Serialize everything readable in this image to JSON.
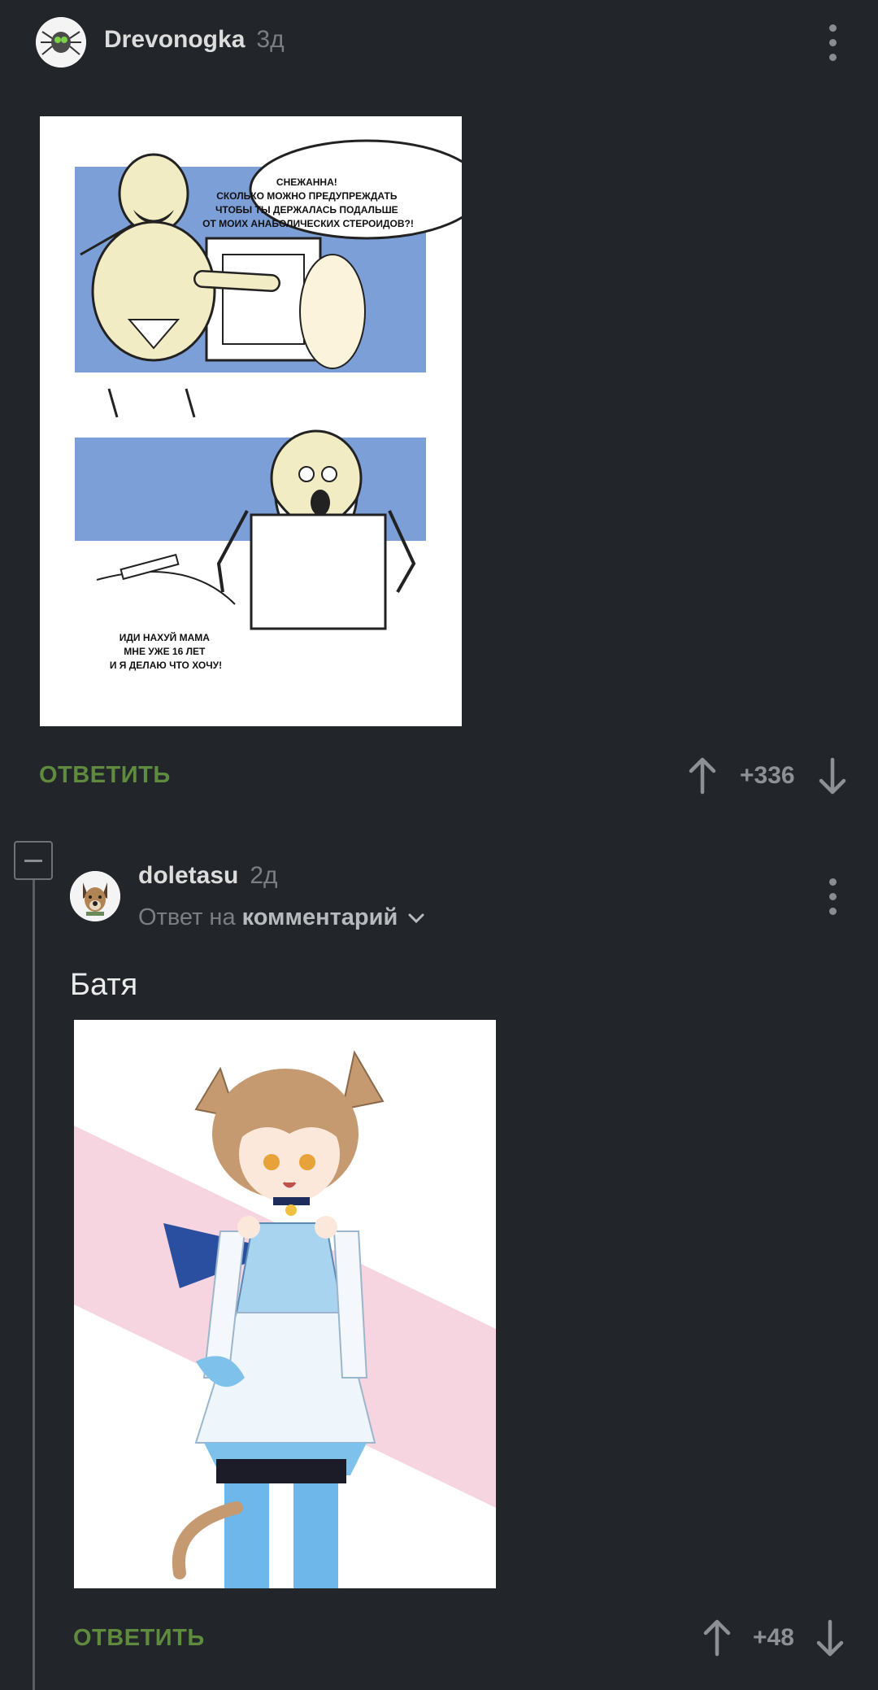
{
  "comment1": {
    "author": "Drevonogka",
    "time": "3д",
    "comic": {
      "bubble_top": "СНЕЖАННА!\nСКОЛЬКО МОЖНО ПРЕДУПРЕЖДАТЬ\nЧТОБЫ ТЫ ДЕРЖАЛАСЬ ПОДАЛЬШЕ\nОТ МОИХ АНАБОЛИЧЕСКИХ СТЕРОИДОВ?!",
      "bubble_bottom": "ИДИ НАХУЙ МАМА\nМНЕ УЖЕ 16 ЛЕТ\nИ Я ДЕЛАЮ ЧТО ХОЧУ!"
    },
    "reply_label": "ОТВЕТИТЬ",
    "rating": "+336"
  },
  "comment2": {
    "author": "doletasu",
    "time": "2д",
    "reply_to_prefix": "Ответ на",
    "reply_to_target": "комментарий",
    "text": "Батя",
    "reply_label": "ОТВЕТИТЬ",
    "rating": "+48"
  },
  "colors": {
    "background": "#22262a",
    "reply_green": "#5f8b3e",
    "comic_blue": "#7d9fd8",
    "anime_pink": "#f7d5e0"
  }
}
